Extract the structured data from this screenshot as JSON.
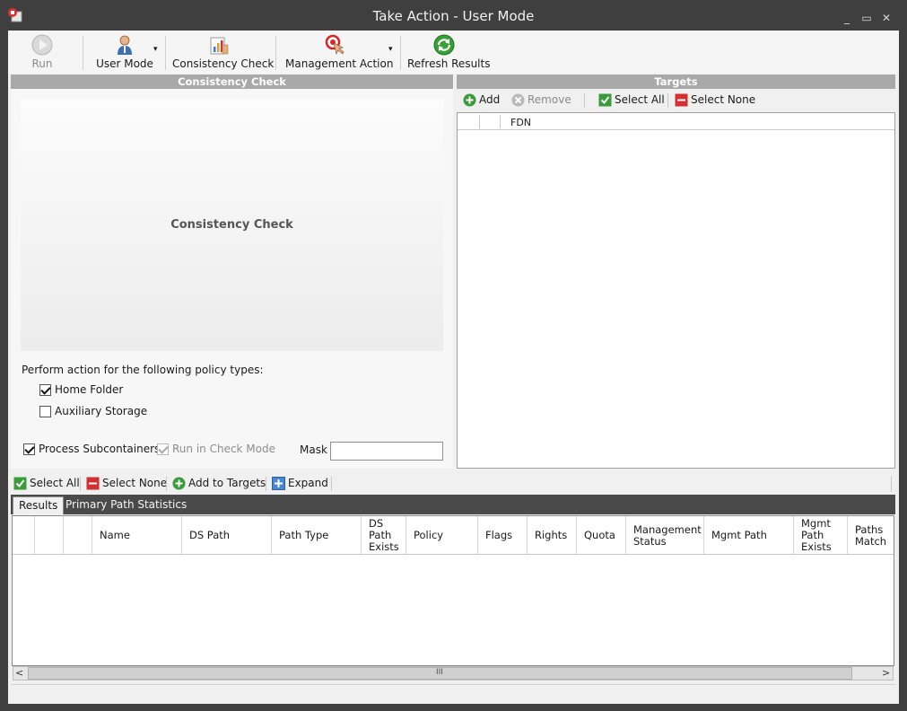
{
  "window": {
    "title": "Take Action - User Mode",
    "controls": {
      "minimize": "_",
      "maximize": "▭",
      "close": "✕"
    }
  },
  "toolbar": {
    "run": "Run",
    "user_mode": "User Mode",
    "consistency_check": "Consistency Check",
    "management_action": "Management Action",
    "refresh_results": "Refresh Results",
    "dropdown_arrow": "▾"
  },
  "consistency_panel": {
    "header": "Consistency Check",
    "placeholder": "Consistency Check",
    "policy_prompt": "Perform action for the following policy types:",
    "home_folder": {
      "label": "Home Folder",
      "checked": true
    },
    "auxiliary_storage": {
      "label": "Auxiliary Storage",
      "checked": false
    },
    "process_subcontainers": {
      "label": "Process Subcontainers",
      "checked": true
    },
    "run_in_check_mode": {
      "label": "Run in Check Mode",
      "checked": true,
      "disabled": true
    },
    "mask_label": "Mask",
    "mask_value": ""
  },
  "targets_panel": {
    "header": "Targets",
    "add": "Add",
    "remove": "Remove",
    "select_all": "Select All",
    "select_none": "Select None",
    "column_fdn": "FDN"
  },
  "results_toolbar": {
    "select_all": "Select All",
    "select_none": "Select None",
    "add_to_targets": "Add to Targets",
    "expand": "Expand"
  },
  "results_tabs": {
    "results": "Results",
    "primary_path_statistics": "Primary Path Statistics"
  },
  "results_columns": {
    "name": "Name",
    "ds_path": "DS Path",
    "path_type": "Path Type",
    "ds_path_exists": "DS Path Exists",
    "policy": "Policy",
    "flags": "Flags",
    "rights": "Rights",
    "quota": "Quota",
    "management_status": "Management Status",
    "mgmt_path": "Mgmt Path",
    "mgmt_path_exists": "Mgmt Path Exists",
    "paths_match": "Paths Match"
  },
  "scrollbar": {
    "left": "<",
    "right": ">",
    "grip": "III"
  },
  "colors": {
    "title_bar": "#3f3f3f",
    "panel_header": "#a9a9a9",
    "add_green": "#3a9b3a",
    "remove_gray": "#9a9a9a",
    "select_none_red": "#d22f2f",
    "refresh_green": "#37a037"
  }
}
